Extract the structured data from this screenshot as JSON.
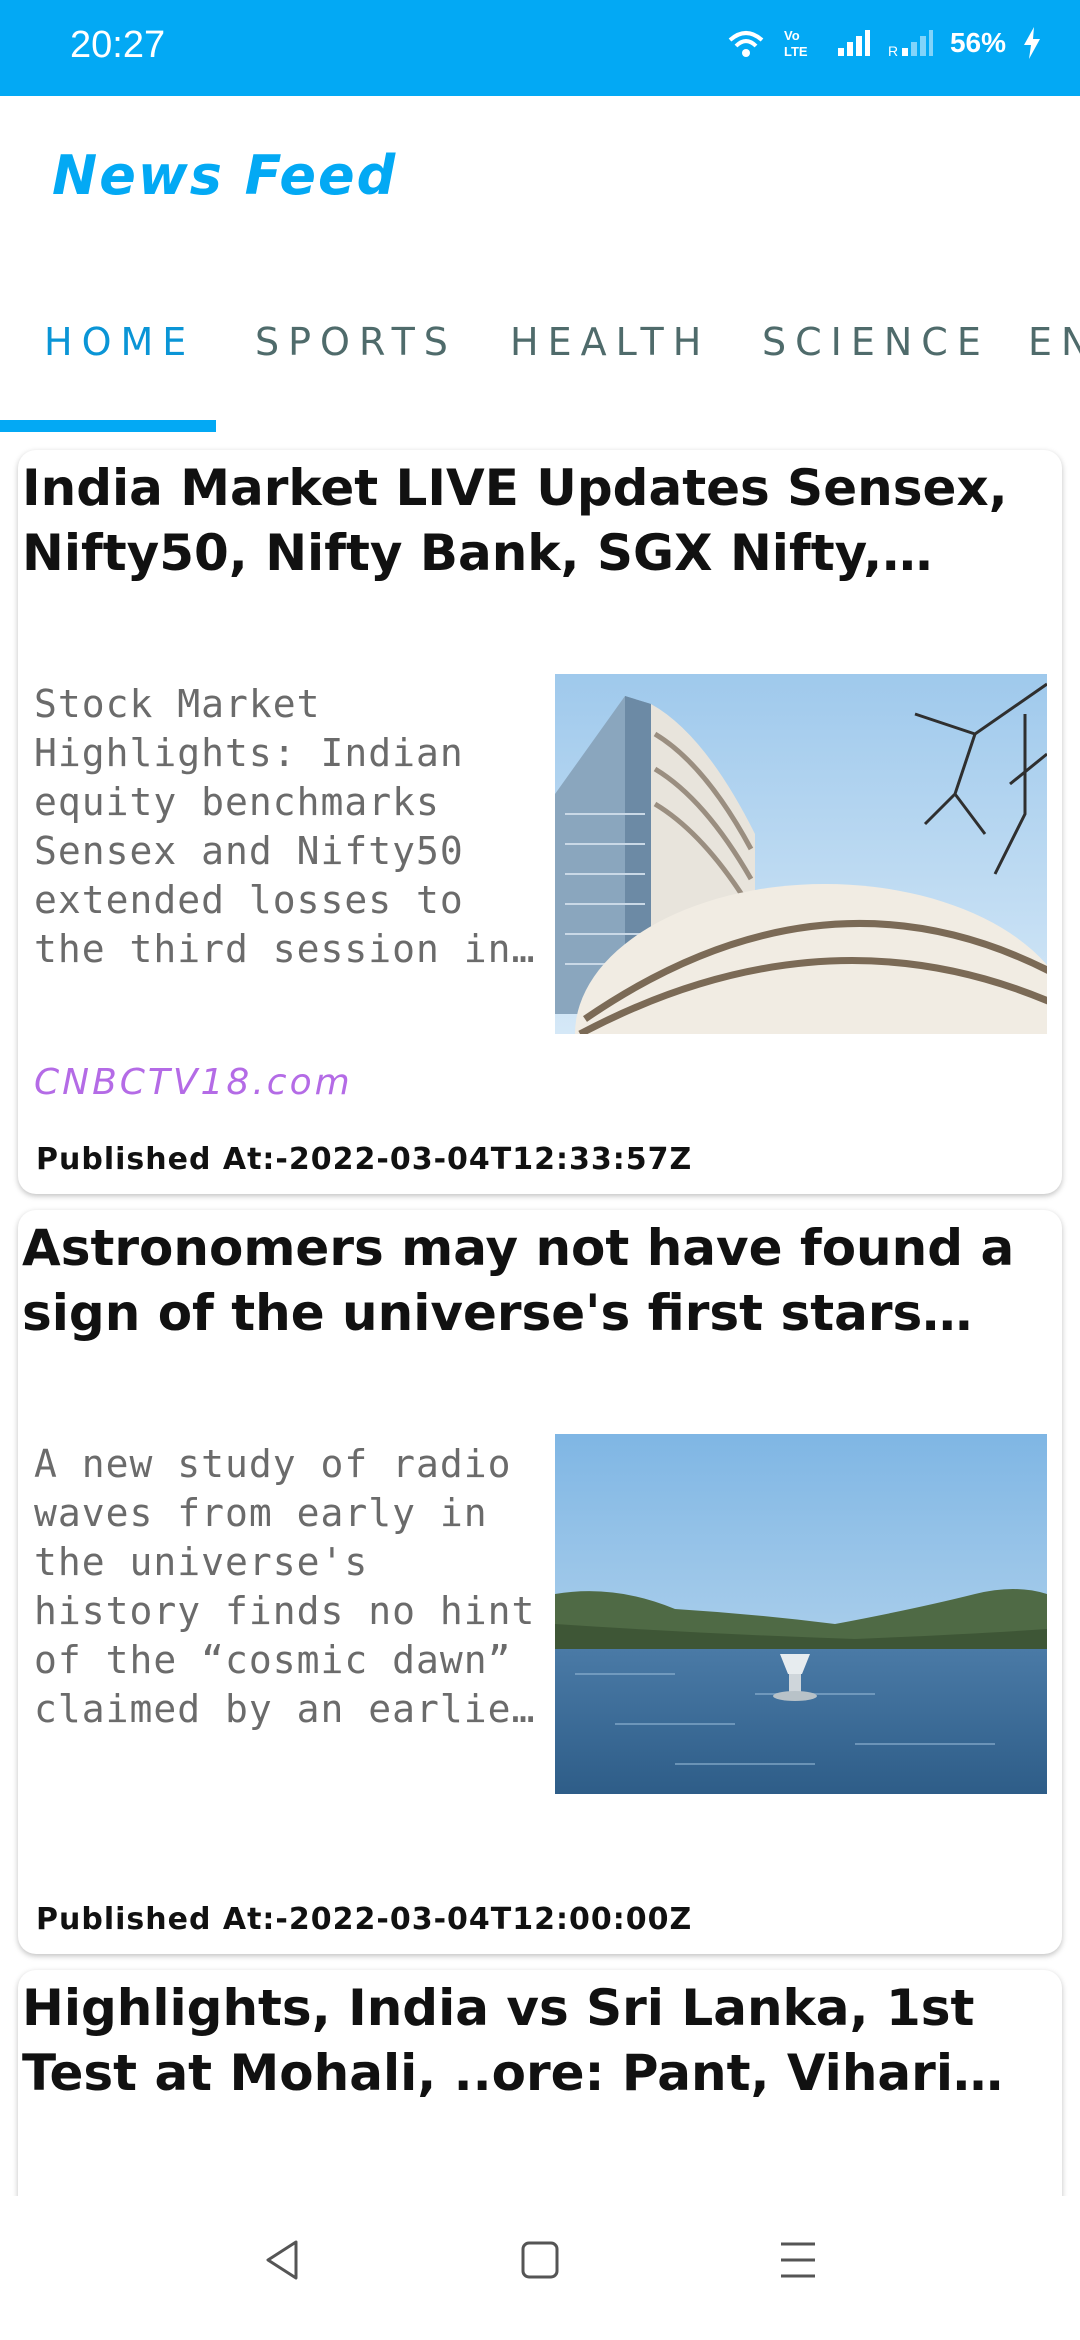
{
  "status_bar": {
    "time": "20:27",
    "battery": "56%",
    "icons": [
      "wifi-icon",
      "volte-icon",
      "signal-icon",
      "signal-roaming-icon",
      "charging-icon"
    ]
  },
  "app": {
    "title": "News Feed"
  },
  "tabs": [
    {
      "label": "HOME",
      "active": true
    },
    {
      "label": "SPORTS",
      "active": false
    },
    {
      "label": "HEALTH",
      "active": false
    },
    {
      "label": "SCIENCE",
      "active": false
    },
    {
      "label": "EN",
      "active": false
    }
  ],
  "articles": [
    {
      "title": "India Market LIVE Updates Sensex, Nifty50, Nifty Bank, SGX Nifty, Russia-Ukraine War",
      "description": "Stock Market Highlights: Indian equity benchmarks Sensex and Nifty50 extended losses to the third session in a row on Friday, as g…",
      "source": "CNBCTV18.com",
      "published": "Published At:-2022-03-04T12:33:57Z",
      "image": "stock-exchange-building"
    },
    {
      "title": "Astronomers may not have found a sign of the universe's first stars after all",
      "description": "A new study of radio waves from early in the universe's history finds no hint of the “cosmic dawn” claimed by an earlier study.",
      "source": "",
      "published": "Published At:-2022-03-04T12:00:00Z",
      "image": "lake-radio-antenna"
    },
    {
      "title": "Highlights, India vs Sri Lanka, 1st Test at Mohali, ..ore: Pant, Vihari shine as …",
      "description": "",
      "source": "",
      "published": "",
      "image": ""
    }
  ],
  "nav": {
    "icons": [
      "back-icon",
      "home-icon",
      "menu-icon"
    ]
  },
  "colors": {
    "accent": "#03A9F4",
    "source": "#b46be6"
  }
}
